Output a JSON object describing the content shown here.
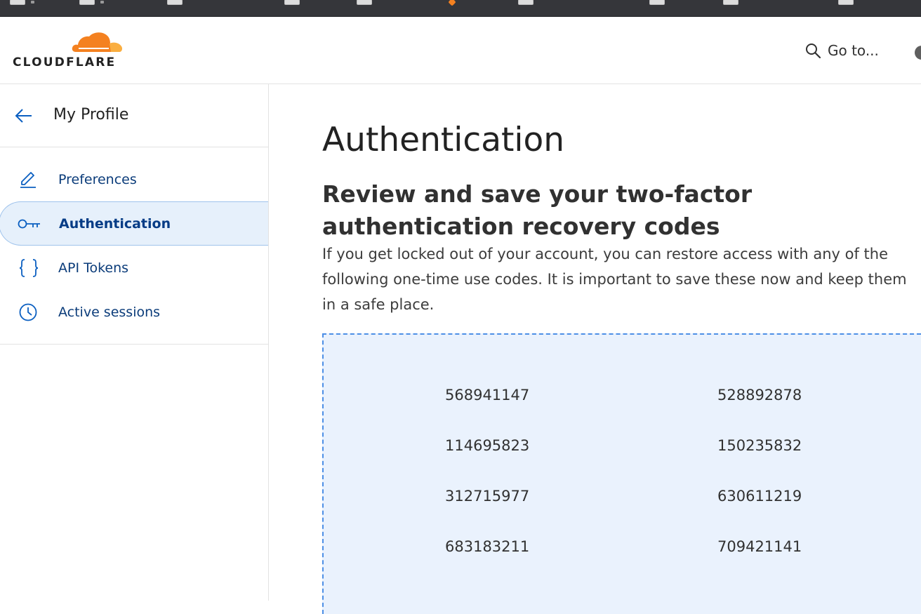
{
  "header": {
    "logo_text": "CLOUDFLARE",
    "logo_icon": "cloudflare-cloud-logo",
    "search_label": "Go to...",
    "search_icon": "search-icon"
  },
  "sidebar": {
    "title": "My Profile",
    "back_icon": "arrow-left-icon",
    "items": [
      {
        "label": "Preferences",
        "icon": "pencil-icon",
        "active": false
      },
      {
        "label": "Authentication",
        "icon": "key-icon",
        "active": true
      },
      {
        "label": "API Tokens",
        "icon": "braces-icon",
        "active": false
      },
      {
        "label": "Active sessions",
        "icon": "clock-icon",
        "active": false
      }
    ]
  },
  "main": {
    "page_title": "Authentication",
    "section_title": "Review and save your two-factor authentication recovery codes",
    "description": "If you get locked out of your account, you can restore access with any of the following one-time use codes. It is important to save these now and keep them in a safe place.",
    "recovery_codes": [
      [
        "568941147",
        "528892878"
      ],
      [
        "114695823",
        "150235832"
      ],
      [
        "312715977",
        "630611219"
      ],
      [
        "683183211",
        "709421141"
      ]
    ]
  },
  "colors": {
    "brand_orange": "#f48120",
    "brand_orange_light": "#faae40",
    "link_blue": "#0b3c7a",
    "active_bg": "#e6f0fb",
    "codes_bg": "#eaf2fd",
    "codes_border": "#4d8fe6"
  }
}
